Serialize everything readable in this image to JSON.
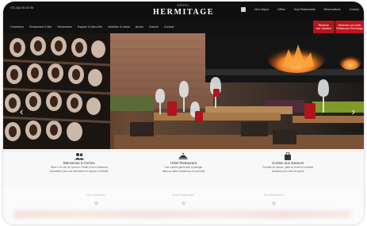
{
  "header": {
    "phone": "+33 (0)4 50 00 00",
    "logo_small": "HÔTEL",
    "logo_big": "HERMITAGE",
    "top_links": [
      "Mon séjour",
      "Offres",
      "Nos Restaurants",
      "Réservations",
      "Contact"
    ],
    "facebook_icon": "facebook-icon"
  },
  "nav": {
    "items": [
      "Chambres",
      "Restaurant & Bar",
      "Séminaires",
      "Espace & bien-être",
      "Activités & loisirs",
      "Accès",
      "Galerie",
      "Contact"
    ],
    "cta_book_line1": "Réserver",
    "cta_book_line2": "une chambre",
    "cta_table_line1": "Réserver une table",
    "cta_table_line2": "Restaurant Hermitage"
  },
  "hero": {
    "prev_arrow": "‹",
    "next_arrow": "›"
  },
  "features": [
    {
      "icon": "group-icon",
      "title": "Bienvenue à Cernex",
      "desc_line1": "Situé à 15 min de Genève, l'Hôtel et son restaurant",
      "desc_line2": "accueillent pour vos séminaires et séjours en famille"
    },
    {
      "icon": "dish-icon",
      "title": "Hôtel Restaurant",
      "desc_line1": "Une cuisine généreuse à partager",
      "desc_line2": "dans un cadre chaleureux et convivial"
    },
    {
      "icon": "bag-icon",
      "title": "Cuisine aux Saveurs",
      "desc_line1": "Produits de saison, plats du terroir et recettes",
      "desc_line2": "créatives pour tous les goûts"
    }
  ],
  "lower": {
    "labels": [
      "Nos Chambres",
      "Notre Restaurant",
      "Nos Séminaires"
    ]
  }
}
